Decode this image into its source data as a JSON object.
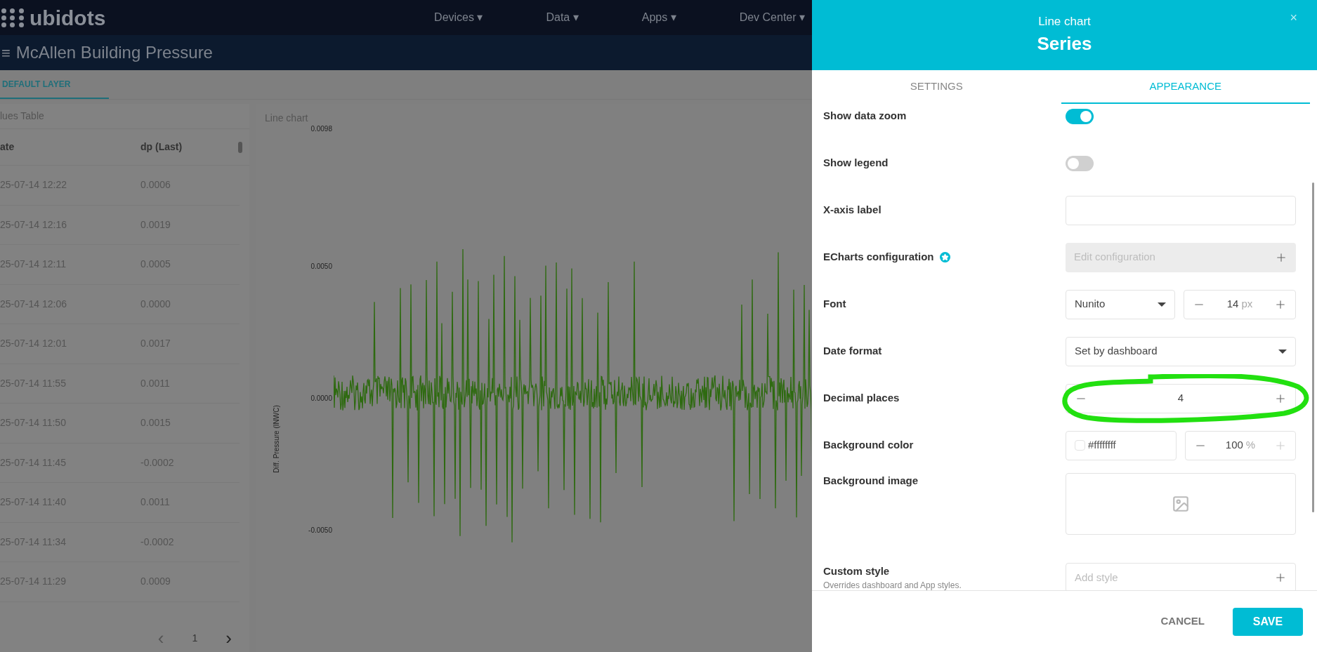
{
  "nav": {
    "logo": "ubidots",
    "menu": [
      "Devices ▾",
      "Data ▾",
      "Apps ▾",
      "Dev Center ▾"
    ]
  },
  "dashboard": {
    "title": "McAllen Building Pressure",
    "menu_icon": "≡",
    "layer_tab": "DEFAULT LAYER"
  },
  "table": {
    "title": "lues Table",
    "columns": [
      "ate",
      "dp (Last)"
    ],
    "rows": [
      [
        "25-07-14 12:22",
        "0.0006"
      ],
      [
        "25-07-14 12:16",
        "0.0019"
      ],
      [
        "25-07-14 12:11",
        "0.0005"
      ],
      [
        "25-07-14 12:06",
        "0.0000"
      ],
      [
        "25-07-14 12:01",
        "0.0017"
      ],
      [
        "25-07-14 11:55",
        "0.0011"
      ],
      [
        "25-07-14 11:50",
        "0.0015"
      ],
      [
        "25-07-14 11:45",
        "-0.0002"
      ],
      [
        "25-07-14 11:40",
        "0.0011"
      ],
      [
        "25-07-14 11:34",
        "-0.0002"
      ],
      [
        "25-07-14 11:29",
        "0.0009"
      ]
    ],
    "pager": {
      "prev": "‹",
      "page": "1",
      "next": "›"
    }
  },
  "chart": {
    "title": "Line chart",
    "ylabel": "Diff. Pressure (INWC)",
    "yticks": [
      "0.0098",
      "0.0050",
      "0.0000",
      "-0.0050"
    ]
  },
  "panel": {
    "subtitle": "Line chart",
    "title": "Series",
    "close": "×",
    "tabs": [
      {
        "label": "SETTINGS",
        "selected": false
      },
      {
        "label": "APPEARANCE",
        "selected": true
      }
    ],
    "rows": [
      {
        "kind": "toggle",
        "label": "Show data zoom",
        "on": true
      },
      {
        "kind": "toggle",
        "label": "Show legend",
        "on": false
      },
      {
        "kind": "text",
        "label": "X-axis label"
      },
      {
        "kind": "config",
        "label": "ECharts configuration",
        "placeholder": "Edit configuration"
      },
      {
        "kind": "font",
        "label": "Font",
        "value": "Nunito",
        "size": "14",
        "unit": "px"
      },
      {
        "kind": "select",
        "label": "Date format",
        "value": "Set by dashboard"
      },
      {
        "kind": "stepper",
        "label": "Decimal places",
        "value": "4"
      },
      {
        "kind": "color",
        "label": "Background color",
        "value": "#ffffffff",
        "opacity": "100",
        "unit": "%"
      },
      {
        "kind": "image",
        "label": "Background image"
      },
      {
        "kind": "style",
        "label": "Custom style",
        "hint": "Overrides dashboard and App styles.",
        "placeholder": "Add style"
      }
    ],
    "buttons": {
      "cancel": "CANCEL",
      "save": "SAVE"
    }
  }
}
